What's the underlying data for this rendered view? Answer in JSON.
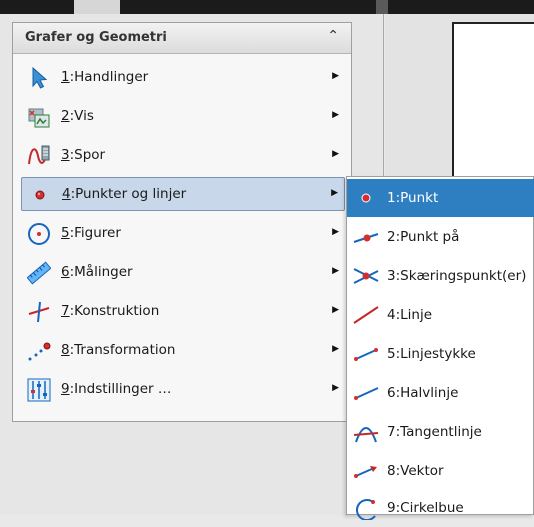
{
  "menu": {
    "title": "Grafer og Geometri",
    "collapse_glyph": "⌃",
    "items": [
      {
        "num": "1",
        "label": ":Handlinger",
        "icon": "pointer-arrow-icon"
      },
      {
        "num": "2",
        "label": ":Vis",
        "icon": "view-icon"
      },
      {
        "num": "3",
        "label": ":Spor",
        "icon": "trace-icon"
      },
      {
        "num": "4",
        "label": ":Punkter og linjer",
        "icon": "point-icon"
      },
      {
        "num": "5",
        "label": ":Figurer",
        "icon": "circle-shape-icon"
      },
      {
        "num": "6",
        "label": ":Målinger",
        "icon": "ruler-icon"
      },
      {
        "num": "7",
        "label": ":Konstruktion",
        "icon": "construction-icon"
      },
      {
        "num": "8",
        "label": ":Transformation",
        "icon": "transformation-icon"
      },
      {
        "num": "9",
        "label": ":Indstillinger …",
        "icon": "settings-sliders-icon"
      }
    ],
    "arrow_glyph": "▶"
  },
  "submenu": {
    "items": [
      {
        "label": "1:Punkt",
        "icon": "point-icon"
      },
      {
        "label": "2:Punkt på",
        "icon": "point-on-icon"
      },
      {
        "label": "3:Skæringspunkt(er)",
        "icon": "intersection-icon"
      },
      {
        "label": "4:Linje",
        "icon": "line-icon"
      },
      {
        "label": "5:Linjestykke",
        "icon": "segment-icon"
      },
      {
        "label": "6:Halvlinje",
        "icon": "ray-icon"
      },
      {
        "label": "7:Tangentlinje",
        "icon": "tangent-icon"
      },
      {
        "label": "8:Vektor",
        "icon": "vector-icon"
      },
      {
        "label": "9:Cirkelbue",
        "icon": "arc-icon"
      }
    ]
  },
  "colors": {
    "accent": "#2e7fc1",
    "selected_bg": "#c8d8ea",
    "point_red": "#d32f2f",
    "line_red": "#c62828",
    "line_blue": "#1565c0"
  }
}
